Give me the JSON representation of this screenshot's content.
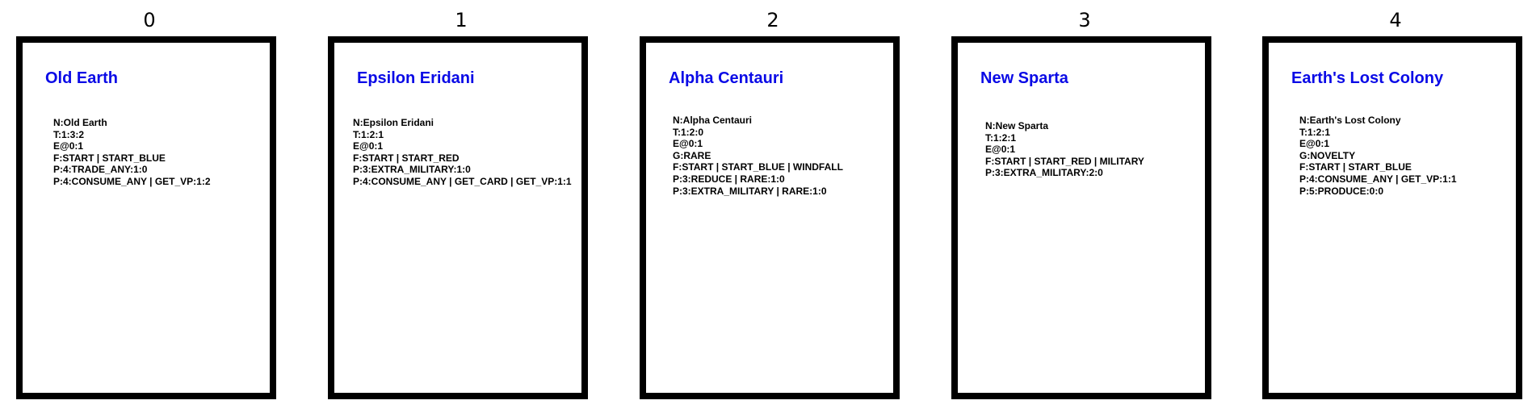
{
  "cards": [
    {
      "index": "0",
      "title": "Old Earth",
      "lines": [
        "N:Old Earth",
        "T:1:3:2",
        "E@0:1",
        "F:START | START_BLUE",
        "P:4:TRADE_ANY:1:0",
        "P:4:CONSUME_ANY | GET_VP:1:2"
      ]
    },
    {
      "index": "1",
      "title": "Epsilon Eridani",
      "lines": [
        "N:Epsilon Eridani",
        "T:1:2:1",
        "E@0:1",
        "F:START | START_RED",
        "P:3:EXTRA_MILITARY:1:0",
        "P:4:CONSUME_ANY | GET_CARD | GET_VP:1:1"
      ]
    },
    {
      "index": "2",
      "title": "Alpha Centauri",
      "lines": [
        "N:Alpha Centauri",
        "T:1:2:0",
        "E@0:1",
        "G:RARE",
        "F:START | START_BLUE | WINDFALL",
        "P:3:REDUCE | RARE:1:0",
        "P:3:EXTRA_MILITARY | RARE:1:0"
      ]
    },
    {
      "index": "3",
      "title": "New Sparta",
      "lines": [
        "N:New Sparta",
        "T:1:2:1",
        "E@0:1",
        "F:START | START_RED | MILITARY",
        "P:3:EXTRA_MILITARY:2:0"
      ]
    },
    {
      "index": "4",
      "title": "Earth's Lost Colony",
      "lines": [
        "N:Earth's Lost Colony",
        "T:1:2:1",
        "E@0:1",
        "G:NOVELTY",
        "F:START | START_BLUE",
        "P:4:CONSUME_ANY | GET_VP:1:1",
        "P:5:PRODUCE:0:0"
      ]
    }
  ]
}
